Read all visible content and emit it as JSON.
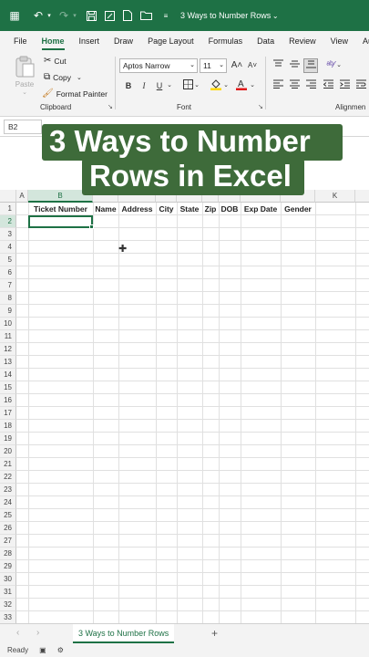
{
  "titlebar": {
    "title": "3 Ways to Number Rows",
    "bg": "#1e7145"
  },
  "menu": {
    "tabs": [
      "File",
      "Home",
      "Insert",
      "Draw",
      "Page Layout",
      "Formulas",
      "Data",
      "Review",
      "View",
      "Autor"
    ],
    "active": "Home"
  },
  "ribbon": {
    "paste_label": "Paste",
    "cut_label": "Cut",
    "copy_label": "Copy",
    "format_painter_label": "Format Painter",
    "clipboard_label": "Clipboard",
    "font_name": "Aptos Narrow",
    "font_size": "11",
    "font_label": "Font",
    "alignment_label": "Alignmen",
    "grow_font": "A˄",
    "shrink_font": "A˅",
    "bold": "B",
    "italic": "I",
    "underline": "U"
  },
  "formula_bar": {
    "name_box": "B2"
  },
  "overlay": {
    "line1": "3 Ways to Number",
    "line2": "Rows in Excel",
    "bg": "#3e6b3a"
  },
  "grid": {
    "col_A": "A",
    "col_B": "B",
    "col_K": "K",
    "headers": [
      "Ticket Number",
      "Name",
      "Address",
      "City",
      "State",
      "Zip",
      "DOB",
      "Exp Date",
      "Gender"
    ],
    "rows": [
      "1",
      "2",
      "3",
      "4",
      "5",
      "6",
      "7",
      "8",
      "9",
      "10",
      "11",
      "12",
      "13",
      "14",
      "15",
      "16",
      "17",
      "18",
      "19",
      "20",
      "21",
      "22",
      "23",
      "24",
      "25",
      "26",
      "27",
      "28",
      "29",
      "30",
      "31",
      "32",
      "33"
    ]
  },
  "sheets": {
    "active": "3 Ways to Number Rows",
    "add_label": "+"
  },
  "status": {
    "ready": "Ready"
  }
}
